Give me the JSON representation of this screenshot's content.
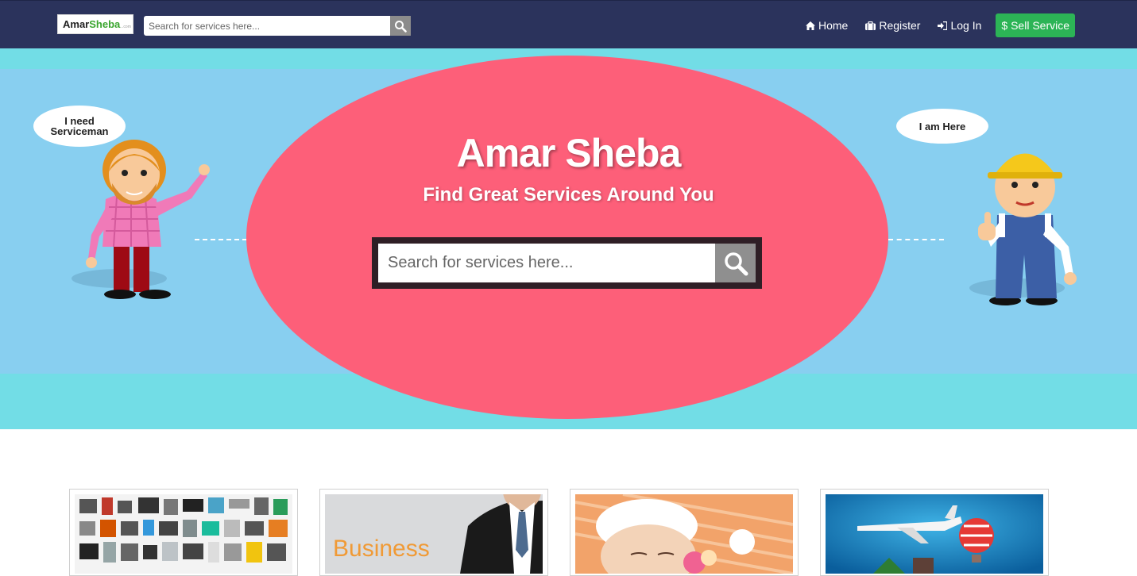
{
  "navbar": {
    "logo": {
      "part1": "Amar",
      "part2": "Sheba",
      "part3": "...com"
    },
    "search_placeholder": "Search for services here...",
    "links": [
      {
        "label": "Home",
        "icon": "home-icon"
      },
      {
        "label": "Register",
        "icon": "briefcase-icon"
      },
      {
        "label": "Log In",
        "icon": "sign-in-icon"
      }
    ],
    "sell_button": "$ Sell Service"
  },
  "hero": {
    "title": "Amar Sheba",
    "subtitle": "Find Great Services Around You",
    "search_placeholder": "Search for services here...",
    "bubble_left": "I need Serviceman",
    "bubble_right": "I am Here",
    "colors": {
      "band": "#88cff0",
      "background": "#72dde6",
      "ellipse": "#fd5f79",
      "search_border": "#2f1f26"
    }
  },
  "cards": [
    {
      "name": "appliances-card",
      "caption": ""
    },
    {
      "name": "business-card",
      "caption": "Business"
    },
    {
      "name": "beauty-card",
      "caption": ""
    },
    {
      "name": "travel-card",
      "caption": ""
    }
  ],
  "colors": {
    "navbar": "#2b335c",
    "sell_button": "#2cb456"
  }
}
